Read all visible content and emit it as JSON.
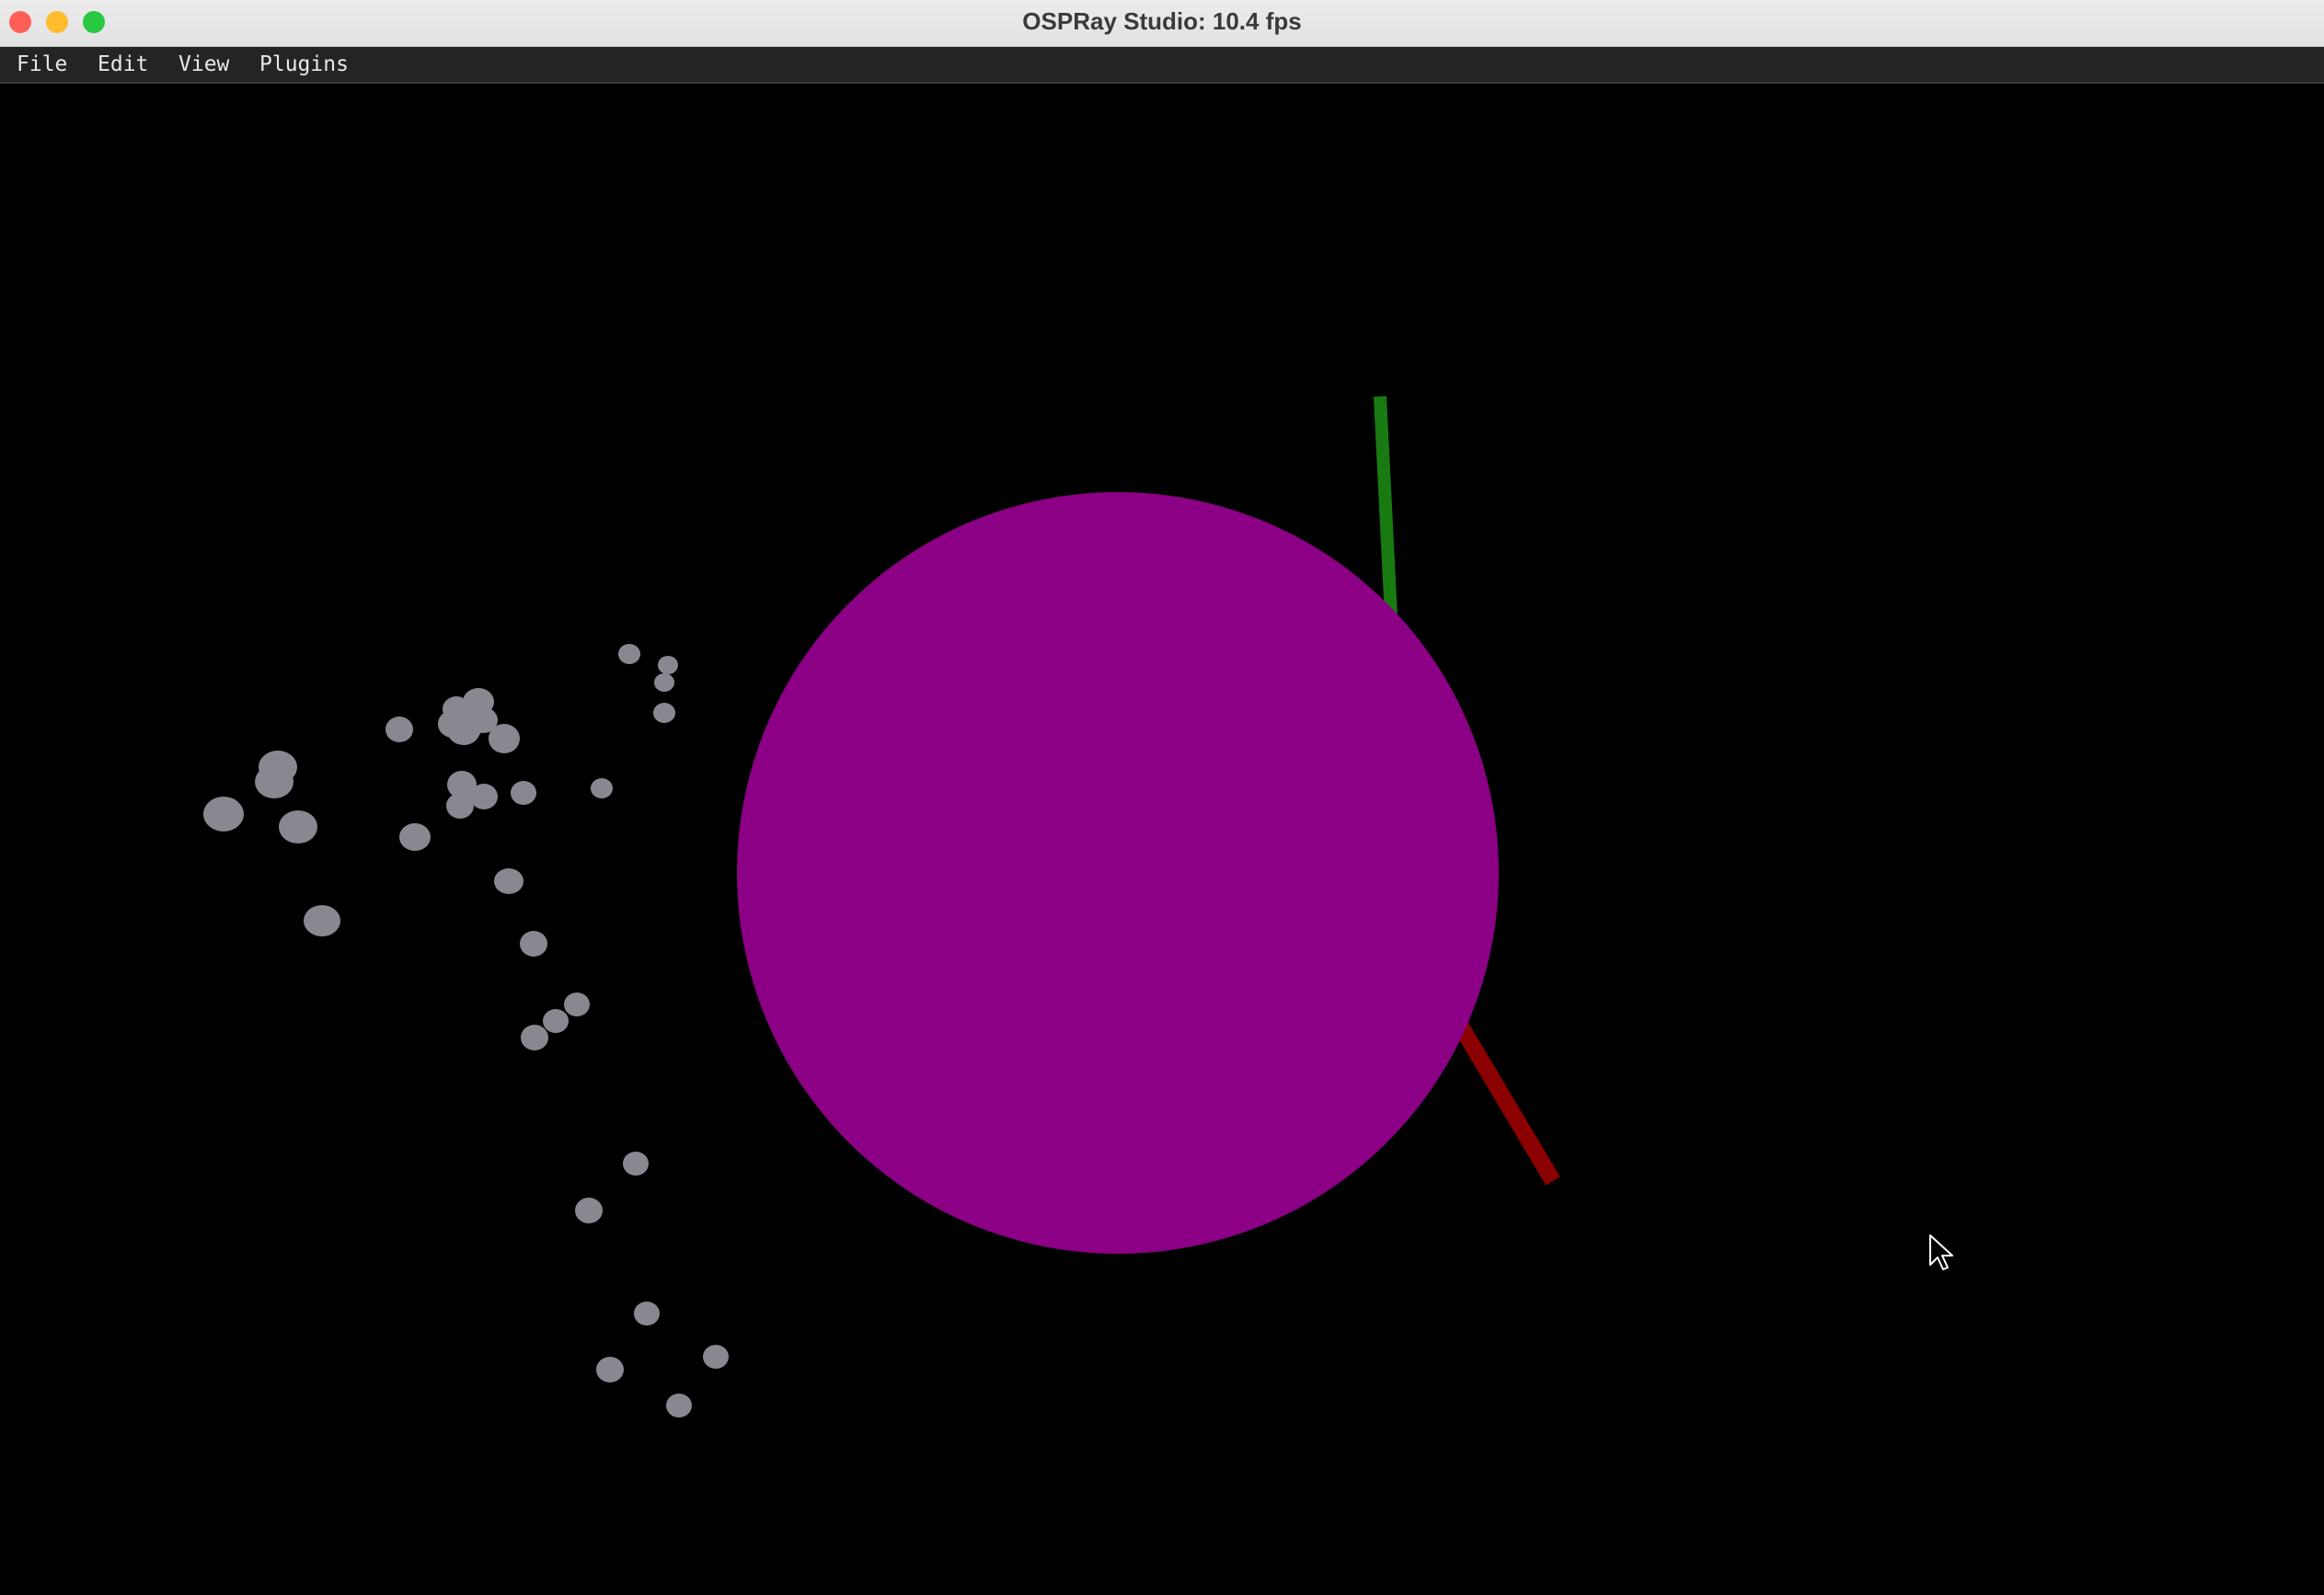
{
  "window": {
    "title": "OSPRay Studio: 10.4 fps",
    "traffic_lights": {
      "close_color": "#ff5f57",
      "minimize_color": "#febc2e",
      "maximize_color": "#28c840"
    }
  },
  "menubar": {
    "items": [
      {
        "label": "File"
      },
      {
        "label": "Edit"
      },
      {
        "label": "View"
      },
      {
        "label": "Plugins"
      }
    ]
  },
  "scene": {
    "background_color": "#000000",
    "sphere": {
      "color": "#8b0085"
    },
    "axes": {
      "y_axis_color": "#1a7a12",
      "x_axis_color": "#8b0000"
    },
    "particles": {
      "color": "#8a8790"
    },
    "cursor": "arrow-cursor-icon"
  }
}
